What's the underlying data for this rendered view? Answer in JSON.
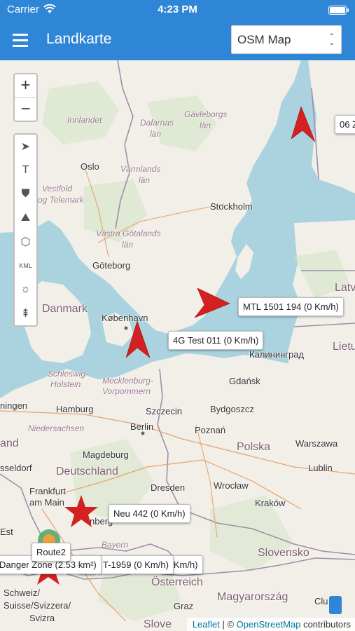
{
  "status_bar": {
    "carrier": "Carrier",
    "time": "4:23 PM",
    "battery_level": 1.0
  },
  "nav": {
    "title": "Landkarte",
    "map_select": {
      "value": "OSM Map"
    }
  },
  "map": {
    "zoom_in": "+",
    "zoom_out": "−",
    "tools": [
      {
        "icon": "navigation-arrow-icon",
        "glyph": "➤"
      },
      {
        "icon": "text-tool-icon",
        "glyph": "T"
      },
      {
        "icon": "shield-icon",
        "glyph": "⛊"
      },
      {
        "icon": "road-icon",
        "glyph": "⛰"
      },
      {
        "icon": "polygon-icon",
        "glyph": "⬡"
      },
      {
        "icon": "kml-icon",
        "glyph": "KML"
      },
      {
        "icon": "sun-icon",
        "glyph": "☼"
      },
      {
        "icon": "tree-icon",
        "glyph": "⇞"
      }
    ],
    "labels": {
      "innlandet": "Innlandet",
      "dalarnas": "Dalarnas",
      "dalarnas_lan": "län",
      "gavleborgs": "Gävleborgs",
      "gavleborgs_lan": "län",
      "oslo": "Oslo",
      "varmlands": "Värmlands",
      "varmlands_lan": "län",
      "vestfold": "Vestfold",
      "og_telemark": "og Telemark",
      "stockholm": "Stockholm",
      "vastra": "Västra Götalands",
      "vastra_lan": "län",
      "goteborg": "Göteborg",
      "danmark": "Danmark",
      "latvi": "Latvi",
      "kobenhavn": "København",
      "lietu": "Lietu",
      "kaliningrad": "Калининград",
      "schleswig": "Schleswig-",
      "holstein": "Holstein",
      "mecklenburg": "Mecklenburg-",
      "vorpommern": "Vorpommern",
      "gdansk": "Gdańsk",
      "hamburg": "Hamburg",
      "ningen": "ningen",
      "szczecin": "Szczecin",
      "bydgoszcz": "Bydgoszcz",
      "niedersachsen": "Niedersachsen",
      "berlin": "Berlin",
      "poznan": "Poznań",
      "and": "and",
      "polska": "Polska",
      "warszawa": "Warszawa",
      "magdeburg": "Magdeburg",
      "deutschland": "Deutschland",
      "sseldorf": "sseldorf",
      "lublin": "Lublin",
      "dresden": "Dresden",
      "wroclaw": "Wrocław",
      "frankfurt": "Frankfurt",
      "am_main": "am Main",
      "krakow": "Kraków",
      "nberg": "nberg",
      "bayern": "Bayern",
      "est": "Est",
      "slovensko": "Slovensko",
      "osterreich": "Österreich",
      "schweiz": "Schweiz/",
      "suisse": "Suisse/Svizzera/",
      "svizra": "Svizra",
      "graz": "Graz",
      "magyarorszag": "Magyarország",
      "slove": "Slove",
      "clu": "Clu"
    },
    "tooltips": {
      "top_right": "06 Z",
      "mtl": "MTL 1501 194 (0 Km/h)",
      "g4": "4G Test 011 (0 Km/h)",
      "neu": "Neu 442 (0 Km/h)",
      "route2": "Route2",
      "danger": "Danger Zone (2.53 km²)",
      "t1959": "T-1959 (0 Km/h)",
      "h_under": "h)",
      "kmh_under": "0 Km/h)"
    },
    "attribution": {
      "leaflet": "Leaflet",
      "separator": " | © ",
      "osm": "OpenStreetMap",
      "suffix": " contributors"
    }
  },
  "colors": {
    "nav_bar": "#2f86d6",
    "water": "#aad3df",
    "land": "#f2efe9",
    "marker": "#d42020",
    "border": "#9e8fa8"
  }
}
